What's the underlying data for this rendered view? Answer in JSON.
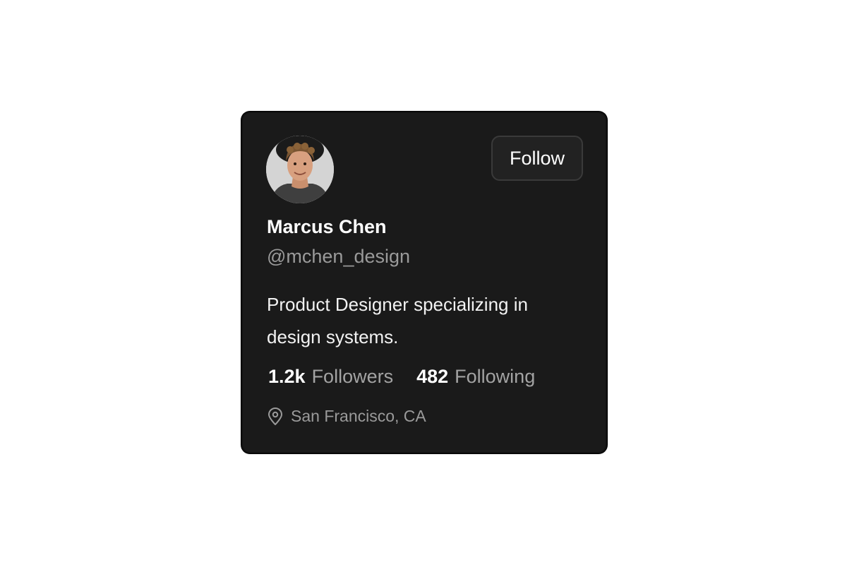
{
  "profile": {
    "name": "Marcus Chen",
    "handle": "@mchen_design",
    "bio": "Product Designer specializing in design systems.",
    "location": "San Francisco, CA",
    "avatar_icon": "avatar-photo",
    "location_icon": "map-pin-icon"
  },
  "actions": {
    "follow_label": "Follow"
  },
  "stats": {
    "followers_value": "1.2k",
    "followers_label": "Followers",
    "following_value": "482",
    "following_label": "Following"
  },
  "colors": {
    "card_background": "#1a1a1a",
    "button_background": "#222222",
    "button_border": "#3a3a3a",
    "primary_text": "#ffffff",
    "secondary_text": "#9a9a9a"
  }
}
